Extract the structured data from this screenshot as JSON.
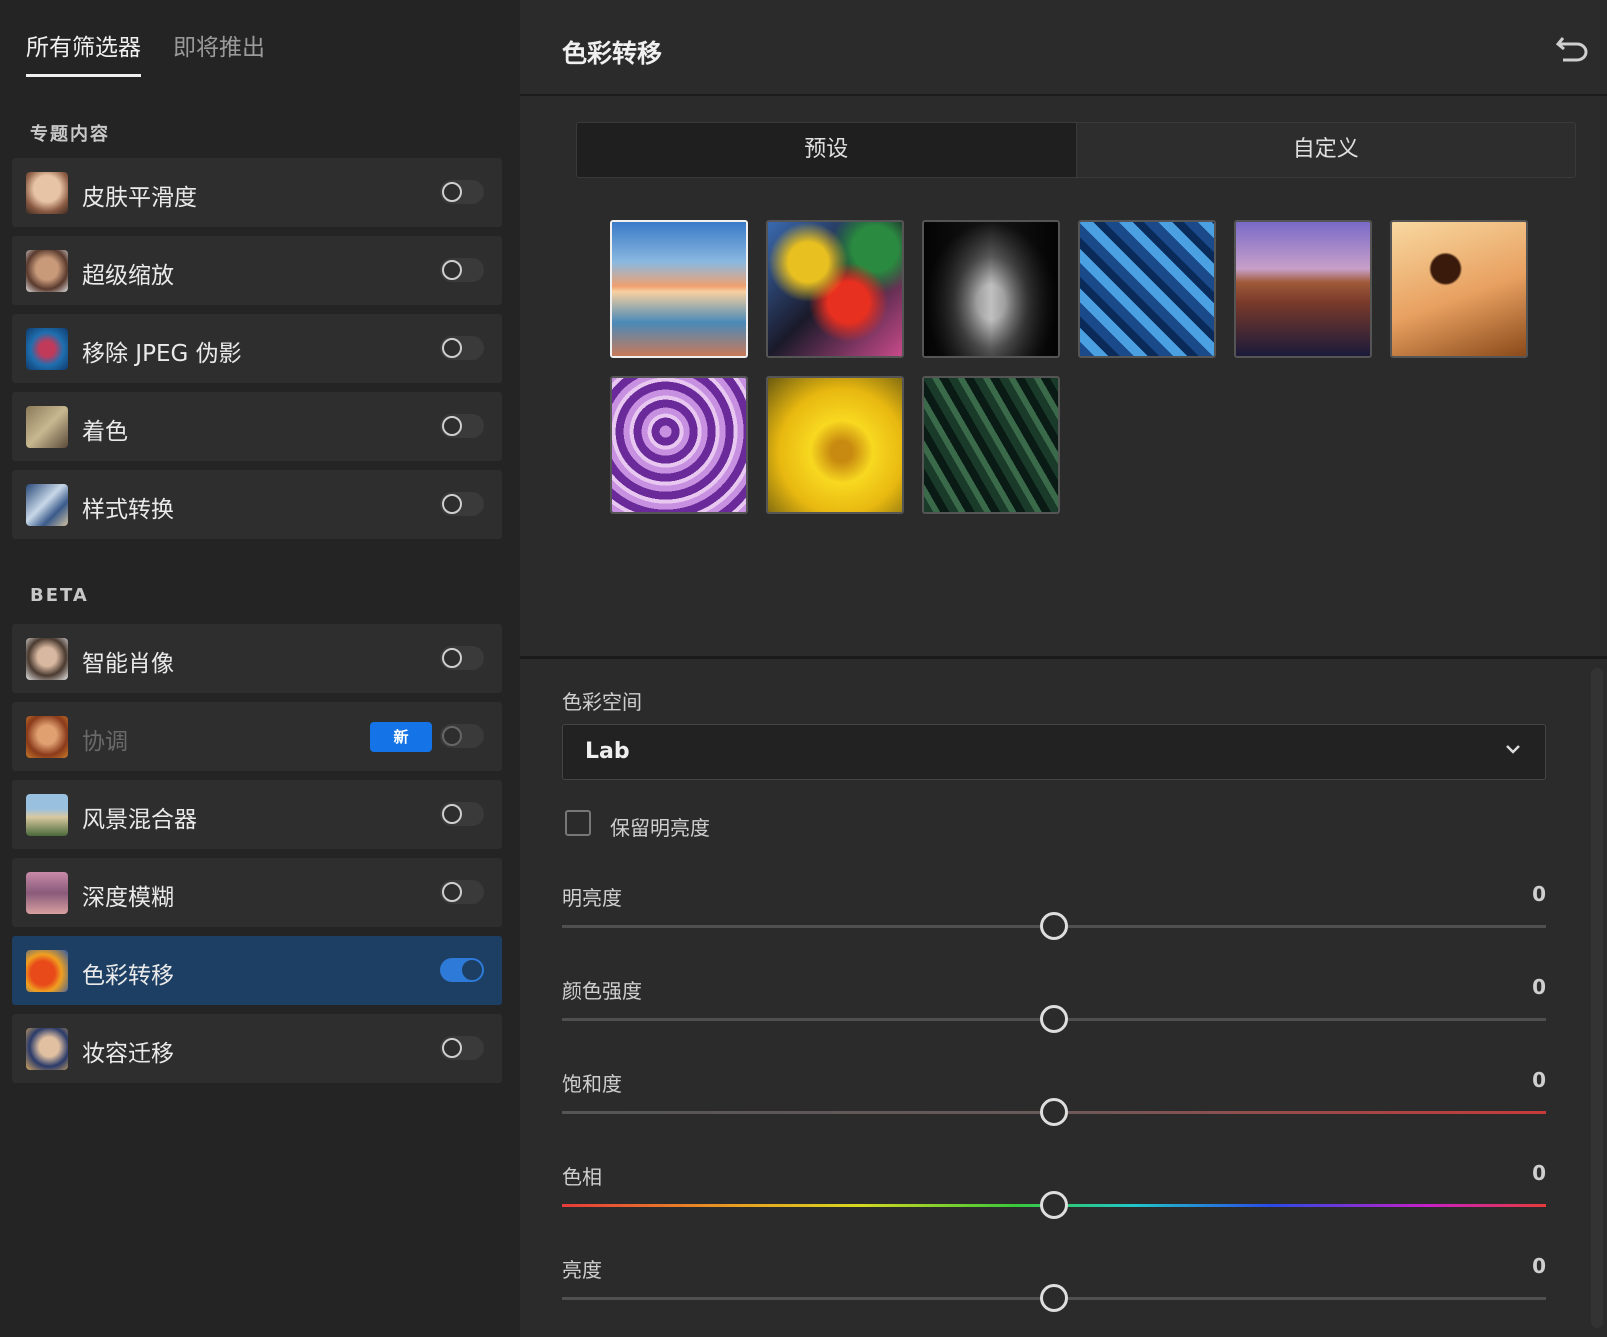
{
  "left_panel": {
    "tabs": [
      {
        "label": "所有筛选器",
        "active": true
      },
      {
        "label": "即将推出",
        "active": false
      }
    ],
    "featured_title": "专题内容",
    "featured": [
      {
        "name": "皮肤平滑度",
        "enabled": false
      },
      {
        "name": "超级缩放",
        "enabled": false
      },
      {
        "name": "移除 JPEG 伪影",
        "enabled": false
      },
      {
        "name": "着色",
        "enabled": false
      },
      {
        "name": "样式转换",
        "enabled": false
      }
    ],
    "beta_title": "BETA",
    "beta": [
      {
        "name": "智能肖像",
        "enabled": false
      },
      {
        "name": "协调",
        "enabled": false,
        "badge": "新",
        "disabled": true
      },
      {
        "name": "风景混合器",
        "enabled": false
      },
      {
        "name": "深度模糊",
        "enabled": false
      },
      {
        "name": "色彩转移",
        "enabled": true,
        "active": true
      },
      {
        "name": "妆容迁移",
        "enabled": false
      }
    ]
  },
  "right_panel": {
    "title": "色彩转移",
    "undo_icon": "undo-icon",
    "segments": [
      {
        "label": "预设",
        "active": true
      },
      {
        "label": "自定义",
        "active": false
      }
    ],
    "presets_selected_index": 0,
    "color_space_label": "色彩空间",
    "color_space_value": "Lab",
    "preserve_luminance_label": "保留明亮度",
    "preserve_luminance_checked": false,
    "sliders": [
      {
        "label": "明亮度",
        "value": "0",
        "position": 0.5
      },
      {
        "label": "颜色强度",
        "value": "0",
        "position": 0.5
      },
      {
        "label": "饱和度",
        "value": "0",
        "position": 0.5
      },
      {
        "label": "色相",
        "value": "0",
        "position": 0.5
      },
      {
        "label": "亮度",
        "value": "0",
        "position": 0.5
      }
    ]
  },
  "colors": {
    "accent": "#1473e6",
    "active_row": "#1d3f63"
  }
}
